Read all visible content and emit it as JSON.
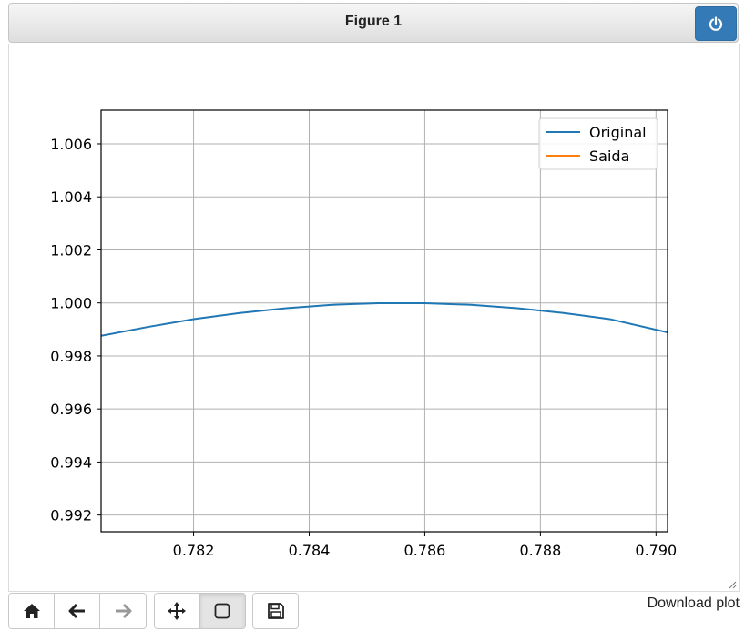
{
  "window": {
    "title": "Figure 1"
  },
  "toolbar": {
    "buttons": [
      {
        "icon": "home-icon",
        "disabled": false
      },
      {
        "icon": "arrow-left-icon",
        "disabled": false
      },
      {
        "icon": "arrow-right-icon",
        "disabled": true
      },
      {
        "icon": "move-icon",
        "disabled": false
      },
      {
        "icon": "zoom-rect-icon",
        "disabled": false,
        "active": true
      },
      {
        "icon": "save-icon",
        "disabled": false
      }
    ],
    "download_label": "Download plot"
  },
  "colors": {
    "power_button": "#337ab7",
    "original": "#1f77b4",
    "saida": "#ff7f0e"
  },
  "chart_data": {
    "type": "line",
    "xlim": [
      0.7804,
      0.7902
    ],
    "ylim": [
      0.99137,
      1.00727
    ],
    "x_ticks": [
      0.782,
      0.784,
      0.786,
      0.788,
      0.79
    ],
    "x_tick_labels": [
      "0.782",
      "0.784",
      "0.786",
      "0.788",
      "0.790"
    ],
    "y_ticks": [
      0.992,
      0.994,
      0.996,
      0.998,
      1.0,
      1.002,
      1.004,
      1.006
    ],
    "y_tick_labels": [
      "0.992",
      "0.994",
      "0.996",
      "0.998",
      "1.000",
      "1.002",
      "1.004",
      "1.006"
    ],
    "grid": true,
    "legend_position": "top-right",
    "series": [
      {
        "name": "Original",
        "color": "#1f77b4",
        "x": [
          0.7804,
          0.7812,
          0.782,
          0.7828,
          0.7836,
          0.7844,
          0.7852,
          0.786,
          0.7868,
          0.7876,
          0.7884,
          0.7892,
          0.7902
        ],
        "y": [
          0.99876,
          0.99909,
          0.99939,
          0.99962,
          0.9998,
          0.99993,
          0.99999,
          0.99999,
          0.99993,
          0.9998,
          0.99962,
          0.99939,
          0.99889
        ]
      },
      {
        "name": "Saida",
        "color": "#ff7f0e",
        "x": [],
        "y": []
      }
    ]
  }
}
